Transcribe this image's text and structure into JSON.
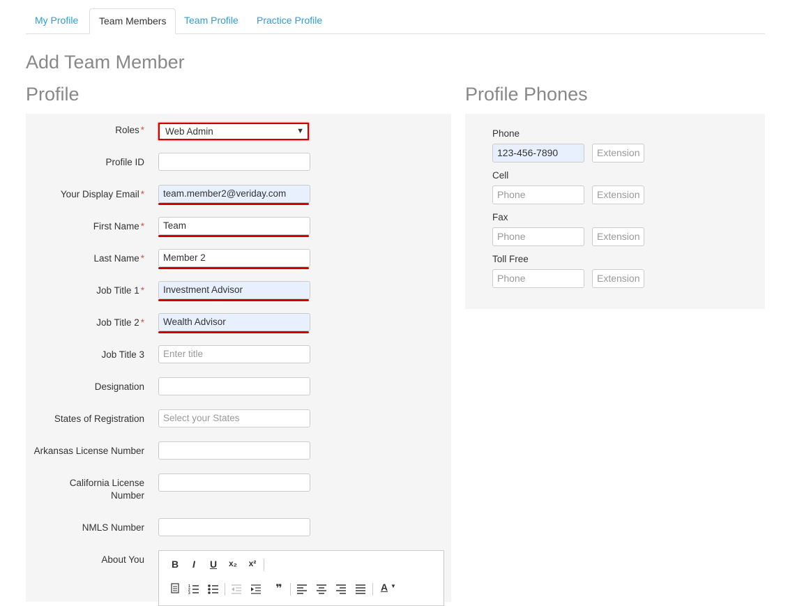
{
  "tabs": [
    {
      "label": "My Profile"
    },
    {
      "label": "Team Members"
    },
    {
      "label": "Team Profile"
    },
    {
      "label": "Practice Profile"
    }
  ],
  "page_title": "Add Team Member",
  "profile": {
    "heading": "Profile",
    "roles": {
      "label": "Roles",
      "value": "Web Admin"
    },
    "profile_id": {
      "label": "Profile ID",
      "value": ""
    },
    "display_email": {
      "label": "Your Display Email",
      "value": "team.member2@veriday.com"
    },
    "first_name": {
      "label": "First Name",
      "value": "Team"
    },
    "last_name": {
      "label": "Last Name",
      "value": "Member 2"
    },
    "job_title_1": {
      "label": "Job Title 1",
      "value": "Investment Advisor"
    },
    "job_title_2": {
      "label": "Job Title 2",
      "value": "Wealth Advisor"
    },
    "job_title_3": {
      "label": "Job Title 3",
      "placeholder": "Enter title"
    },
    "designation": {
      "label": "Designation",
      "value": ""
    },
    "states": {
      "label": "States of Registration",
      "placeholder": "Select your States"
    },
    "arkansas": {
      "label": "Arkansas License Number",
      "value": ""
    },
    "california": {
      "label_line1": "California License",
      "label_line2": "Number",
      "value": ""
    },
    "nmls": {
      "label": "NMLS Number",
      "value": ""
    },
    "about": {
      "label": "About You"
    },
    "required_mark": "*"
  },
  "editor_toolbar": {
    "bold": "B",
    "italic": "I",
    "underline": "U",
    "subscript": "x₂",
    "superscript": "x²",
    "quote": "❞",
    "font_color": "A"
  },
  "phones": {
    "heading": "Profile Phones",
    "phone": {
      "label": "Phone",
      "value": "123-456-7890",
      "ext_placeholder": "Extension"
    },
    "cell": {
      "label": "Cell",
      "placeholder": "Phone",
      "ext_placeholder": "Extension"
    },
    "fax": {
      "label": "Fax",
      "placeholder": "Phone",
      "ext_placeholder": "Extension"
    },
    "toll_free": {
      "label": "Toll Free",
      "placeholder": "Phone",
      "ext_placeholder": "Extension"
    }
  },
  "colors": {
    "accent": "#2e9ed3",
    "required": "#d9534f",
    "highlight": "#d00000"
  }
}
